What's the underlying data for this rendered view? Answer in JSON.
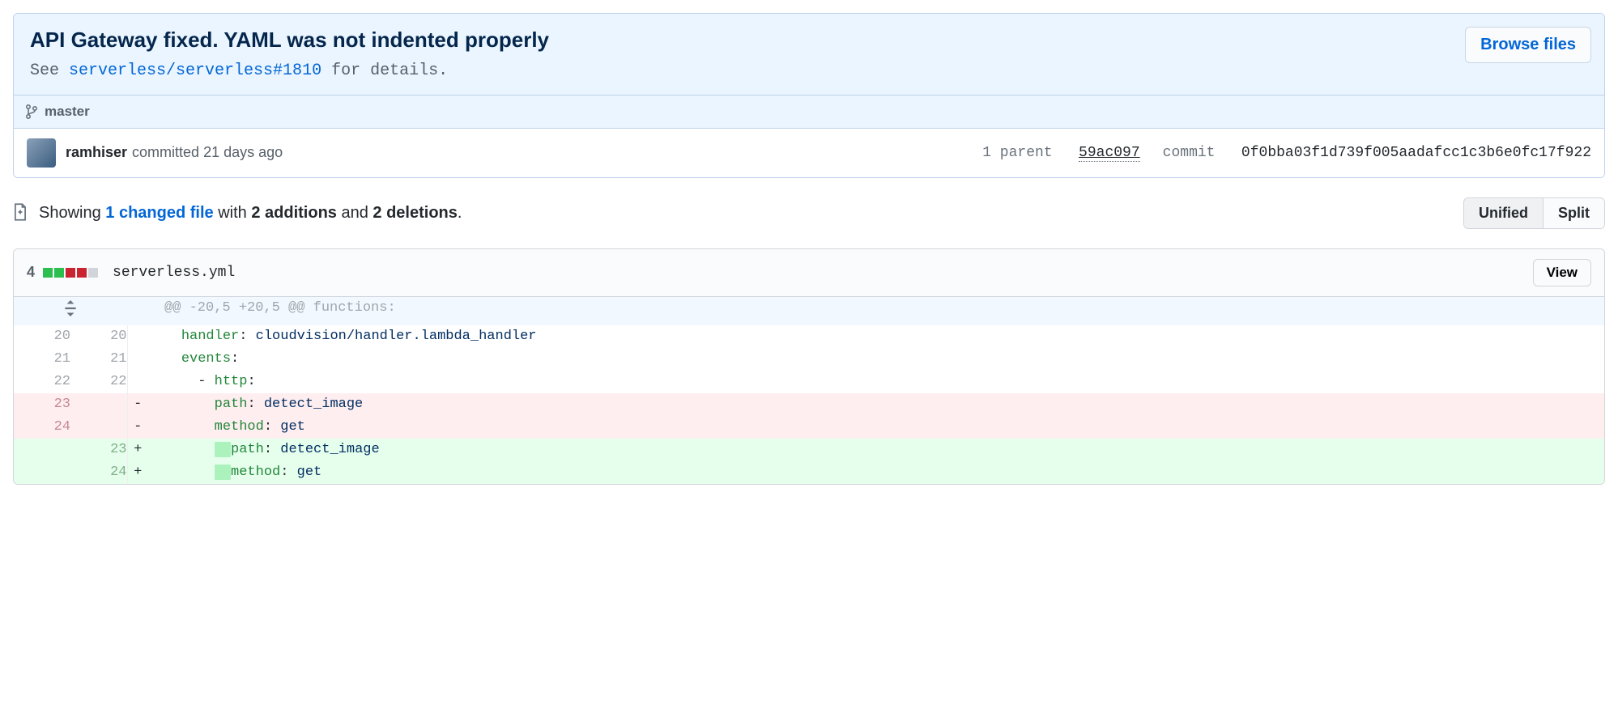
{
  "commit": {
    "title": "API Gateway fixed. YAML was not indented properly",
    "description_prefix": "See ",
    "description_link": "serverless/serverless#1810",
    "description_suffix": " for details.",
    "browse_files_label": "Browse files",
    "branch": "master",
    "author": "ramhiser",
    "committed_text": "committed 21 days ago",
    "parent_label": "1 parent",
    "parent_sha_short": "59ac097",
    "commit_label": "commit",
    "commit_sha_full": "0f0bba03f1d739f005aadafcc1c3b6e0fc17f922"
  },
  "toolbar": {
    "showing_prefix": "Showing ",
    "changed_files_link": "1 changed file",
    "with_text": " with ",
    "additions_text": "2 additions",
    "and_text": " and ",
    "deletions_text": "2 deletions",
    "period": ".",
    "unified_label": "Unified",
    "split_label": "Split"
  },
  "file": {
    "changes_count": "4",
    "name": "serverless.yml",
    "view_label": "View",
    "hunk_header": "@@ -20,5 +20,5 @@ functions:"
  },
  "diff_rows": [
    {
      "type": "ctx",
      "old": "20",
      "new": "20",
      "marker": " ",
      "segments": [
        {
          "t": "    ",
          "c": ""
        },
        {
          "t": "handler",
          "c": "tok-key"
        },
        {
          "t": ": ",
          "c": ""
        },
        {
          "t": "cloudvision/handler.lambda_handler",
          "c": "tok-val"
        }
      ]
    },
    {
      "type": "ctx",
      "old": "21",
      "new": "21",
      "marker": " ",
      "segments": [
        {
          "t": "    ",
          "c": ""
        },
        {
          "t": "events",
          "c": "tok-key"
        },
        {
          "t": ":",
          "c": ""
        }
      ]
    },
    {
      "type": "ctx",
      "old": "22",
      "new": "22",
      "marker": " ",
      "segments": [
        {
          "t": "      - ",
          "c": ""
        },
        {
          "t": "http",
          "c": "tok-key"
        },
        {
          "t": ":",
          "c": ""
        }
      ]
    },
    {
      "type": "del",
      "old": "23",
      "new": "",
      "marker": "-",
      "segments": [
        {
          "t": "        ",
          "c": ""
        },
        {
          "t": "path",
          "c": "tok-key"
        },
        {
          "t": ": ",
          "c": ""
        },
        {
          "t": "detect_image",
          "c": "tok-val"
        }
      ]
    },
    {
      "type": "del",
      "old": "24",
      "new": "",
      "marker": "-",
      "segments": [
        {
          "t": "        ",
          "c": ""
        },
        {
          "t": "method",
          "c": "tok-key"
        },
        {
          "t": ": ",
          "c": ""
        },
        {
          "t": "get",
          "c": "tok-val"
        }
      ]
    },
    {
      "type": "add",
      "old": "",
      "new": "23",
      "marker": "+",
      "segments": [
        {
          "t": "        ",
          "c": ""
        },
        {
          "t": "  ",
          "c": "hl-add"
        },
        {
          "t": "path",
          "c": "tok-key"
        },
        {
          "t": ": ",
          "c": ""
        },
        {
          "t": "detect_image",
          "c": "tok-val"
        }
      ]
    },
    {
      "type": "add",
      "old": "",
      "new": "24",
      "marker": "+",
      "segments": [
        {
          "t": "        ",
          "c": ""
        },
        {
          "t": "  ",
          "c": "hl-add"
        },
        {
          "t": "method",
          "c": "tok-key"
        },
        {
          "t": ": ",
          "c": ""
        },
        {
          "t": "get",
          "c": "tok-val"
        }
      ]
    }
  ]
}
